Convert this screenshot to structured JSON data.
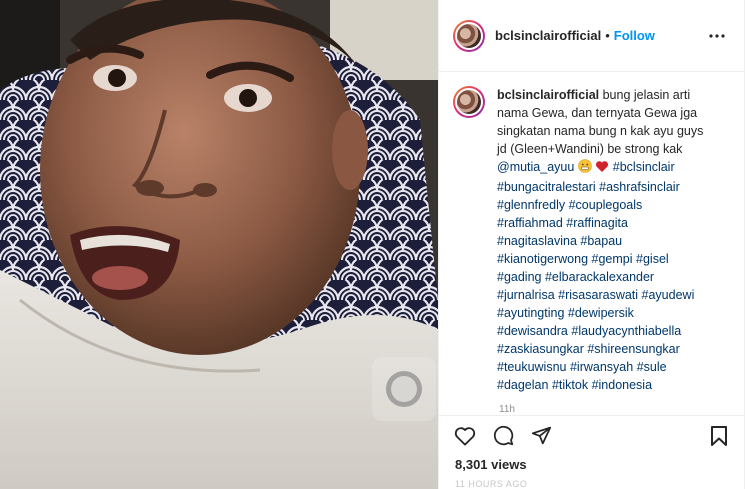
{
  "post": {
    "username": "bclsinclairofficial",
    "follow_label": "Follow",
    "separator": "•",
    "caption": {
      "username": "bclsinclairofficial",
      "text_1": "bung jelasin arti nama Gewa, dan ternyata Gewa jga singkatan nama bung n kak ayu guys jd (Gleen+Wandini) be strong kak",
      "mention": "@mutia_ayuu",
      "hashtags": [
        "#bclsinclair",
        "#bungacitralestari",
        "#ashrafsinclair",
        "#glennfredly",
        "#couplegoals",
        "#raffiahmad",
        "#raffinagita",
        "#nagitaslavina",
        "#bapau",
        "#kianotigerwong",
        "#gempi",
        "#gisel",
        "#gading",
        "#elbarackalexander",
        "#jurnalrisa",
        "#risasaraswati",
        "#ayudewi",
        "#ayutingting",
        "#dewipersik",
        "#dewisandra",
        "#laudyacynthiabella",
        "#zaskiasungkar",
        "#shireensungkar",
        "#teukuwisnu",
        "#irwansyah",
        "#sule",
        "#dagelan",
        "#tiktok",
        "#indonesia"
      ],
      "time": "11h"
    },
    "views": "8,301 views",
    "cutoff_text": "11 HOURS AGO"
  },
  "icons": {
    "more": "more-horizontal-icon",
    "like": "heart-icon",
    "comment": "comment-icon",
    "share": "send-icon",
    "save": "bookmark-icon",
    "emoji_1": "grimacing-face-emoji",
    "emoji_2": "red-heart-emoji"
  },
  "colors": {
    "link": "#00376b",
    "follow": "#0095f6",
    "muted": "#8e8e8e",
    "text": "#262626"
  }
}
